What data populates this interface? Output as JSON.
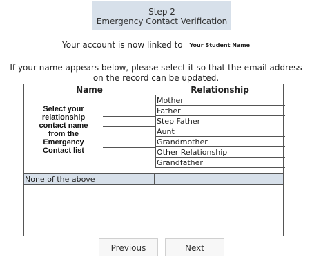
{
  "header": {
    "step": "Step 2",
    "title": "Emergency Contact Verification"
  },
  "linked": {
    "text": "Your account is now linked to",
    "student_name": "Your Student Name"
  },
  "instruction": {
    "line1": "If your name appears below, please select it so that the email address",
    "line2": "on the record can be updated."
  },
  "table": {
    "col_name": "Name",
    "col_relationship": "Relationship",
    "prompt_lines": [
      "Select your",
      "relationship",
      "contact name",
      "from the",
      "Emergency",
      "Contact list"
    ],
    "relationships": [
      "Mother",
      "Father",
      "Step Father",
      "Aunt",
      "Grandmother",
      "Other Relationship",
      "Grandfather"
    ],
    "none_option": "None of the above"
  },
  "buttons": {
    "previous": "Previous",
    "next": "Next"
  },
  "colors": {
    "header_bg": "#d7e0ea",
    "highlight_row_bg": "#d7e0ea"
  }
}
